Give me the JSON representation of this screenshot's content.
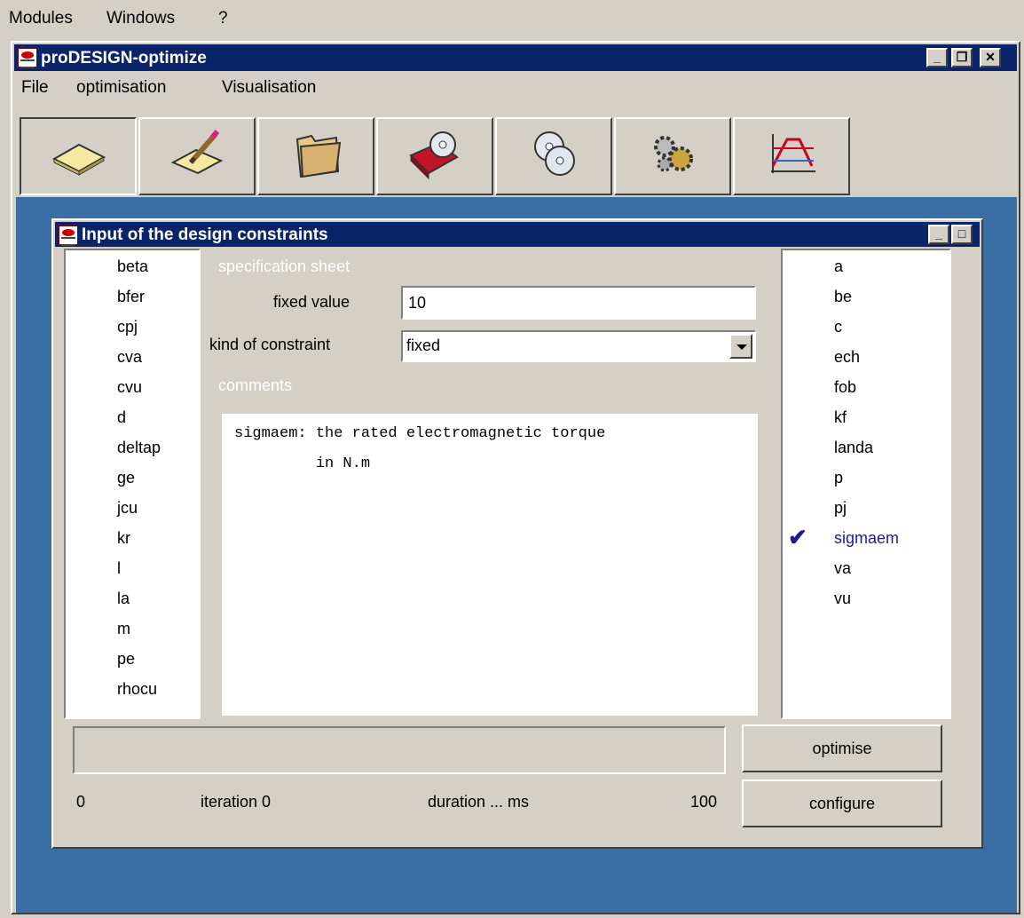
{
  "app_menubar": [
    "Modules",
    "Windows",
    "?"
  ],
  "outer_window": {
    "title": "proDESIGN-optimize",
    "menu": [
      "File",
      "optimisation",
      "Visualisation"
    ]
  },
  "toolbar": {
    "icons": [
      "new-document-icon",
      "edit-document-icon",
      "open-folder-icon",
      "book-cd-icon",
      "cd-stack-icon",
      "gears-icon",
      "chart-icon"
    ]
  },
  "inner_window": {
    "title": "Input of the design constraints",
    "left_list": [
      "beta",
      "bfer",
      "cpj",
      "cva",
      "cvu",
      "d",
      "deltap",
      "ge",
      "jcu",
      "kr",
      "l",
      "la",
      "m",
      "pe",
      "rhocu"
    ],
    "right_list": [
      "a",
      "be",
      "c",
      "ech",
      "fob",
      "kf",
      "landa",
      "p",
      "pj",
      "sigmaem",
      "va",
      "vu"
    ],
    "selected_item": "sigmaem",
    "spec_label": "specification sheet",
    "fixed_value_label": "fixed value",
    "fixed_value": "10",
    "kind_label": "kind of constraint",
    "kind_value": "fixed",
    "comments_label": "comments",
    "comments_text": "sigmaem: the rated electromagnetic torque\n         in N.m",
    "optimise_label": "optimise",
    "configure_label": "configure",
    "status": {
      "start": "0",
      "iteration": "iteration  0",
      "duration": "duration  ... ms",
      "end": "100"
    }
  },
  "colors": {
    "title_bar": "#0a246a",
    "desktop": "#3a6ea5",
    "selected_text": "#1c1c8f"
  }
}
